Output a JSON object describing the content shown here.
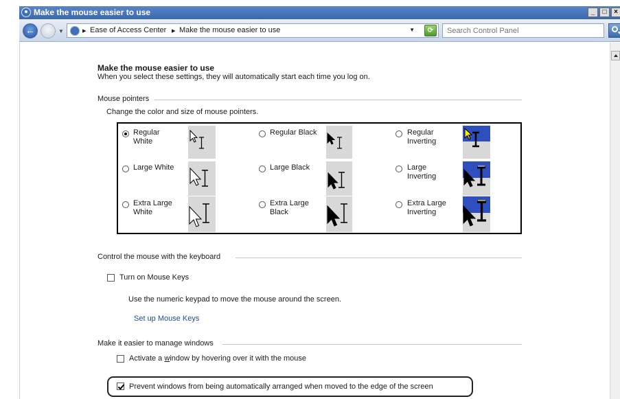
{
  "window": {
    "title": "Make the mouse easier to use",
    "min_label": "_",
    "max_label": "□",
    "close_label": "×"
  },
  "address": {
    "crumbs": [
      "Ease of Access Center",
      "Make the mouse easier to use"
    ],
    "separator": "▸",
    "search_placeholder": "Search Control Panel"
  },
  "page": {
    "heading": "Make the mouse easier to use",
    "subtitle": "When you select these settings, they will automatically start each time you log on."
  },
  "mouse_pointers": {
    "group_label": "Mouse pointers",
    "description": "Change the color and size of mouse pointers.",
    "selected": "Regular White",
    "options": [
      {
        "line1": "Regular",
        "line2": "White",
        "selected": true
      },
      {
        "line1": "Regular Black",
        "line2": "",
        "selected": false
      },
      {
        "line1": "Regular",
        "line2": "Inverting",
        "selected": false
      },
      {
        "line1": "Large White",
        "line2": "",
        "selected": false
      },
      {
        "line1": "Large Black",
        "line2": "",
        "selected": false
      },
      {
        "line1": "Large",
        "line2": "Inverting",
        "selected": false
      },
      {
        "line1": "Extra Large",
        "line2": "White",
        "selected": false
      },
      {
        "line1": "Extra Large",
        "line2": "Black",
        "selected": false
      },
      {
        "line1": "Extra Large",
        "line2": "Inverting",
        "selected": false
      }
    ]
  },
  "keyboard": {
    "group_label": "Control the mouse with the keyboard",
    "mouse_keys_label": "Turn on Mouse Keys",
    "mouse_keys_checked": false,
    "description": "Use the numeric keypad to move the mouse around the screen.",
    "setup_link": "Set up Mouse Keys"
  },
  "windows": {
    "group_label": "Make it easier to manage windows",
    "hover_prefix": "Activate a ",
    "hover_key": "w",
    "hover_suffix": "indow by hovering over it with the mouse",
    "hover_checked": false,
    "prevent_label": "Prevent windows from being automatically arranged when moved to the edge of the screen",
    "prevent_checked": true
  }
}
